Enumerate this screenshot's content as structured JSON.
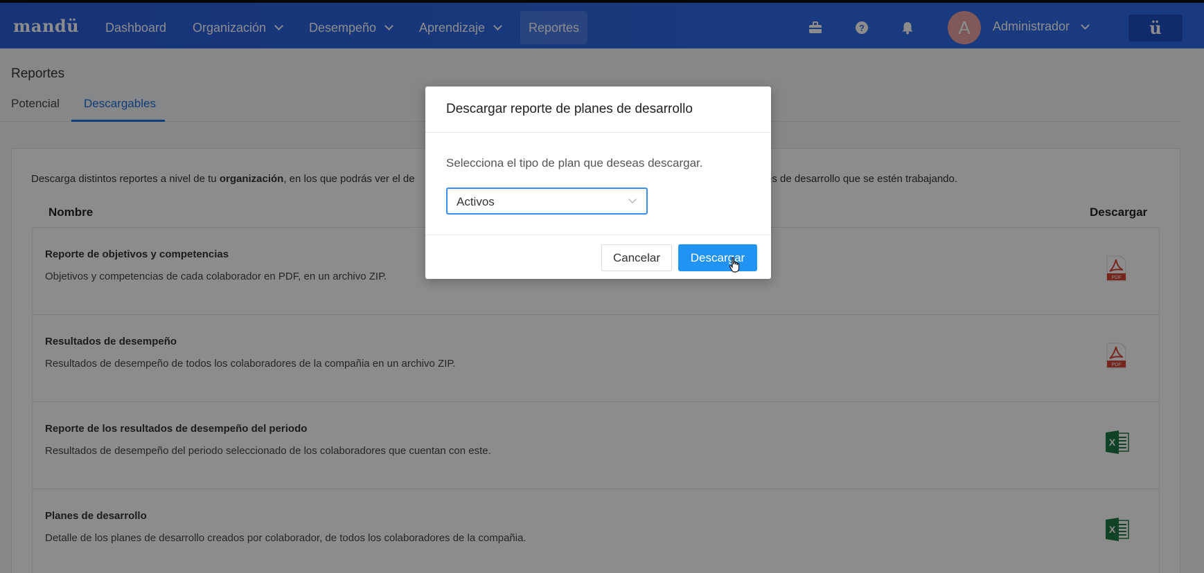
{
  "navbar": {
    "logo": "mandü",
    "items": [
      {
        "label": "Dashboard"
      },
      {
        "label": "Organización"
      },
      {
        "label": "Desempeño"
      },
      {
        "label": "Aprendizaje"
      },
      {
        "label": "Reportes"
      }
    ],
    "user": {
      "initial": "A",
      "name": "Administrador"
    },
    "brand_button": "ü",
    "icons": [
      "briefcase-icon",
      "help-icon",
      "bell-icon"
    ]
  },
  "page": {
    "title": "Reportes",
    "tabs": [
      {
        "label": "Potencial"
      },
      {
        "label": "Descargables"
      }
    ],
    "active_tab": "Descargables"
  },
  "content": {
    "intro_start": "Descarga distintos reportes a nivel de tu ",
    "intro_bold": "organización",
    "intro_mid": ", en los que podrás ver el de",
    "intro_end": "es de desarrollo que se estén trabajando.",
    "columns": {
      "name": "Nombre",
      "download": "Descargar"
    },
    "rows": [
      {
        "title": "Reporte de objetivos y competencias",
        "description": "Objetivos y competencias de cada colaborador en PDF, en un archivo ZIP.",
        "icon": "pdf-icon"
      },
      {
        "title": "Resultados de desempeño",
        "description": "Resultados de desempeño de todos los colaboradores de la compañia en un archivo ZIP.",
        "icon": "pdf-icon"
      },
      {
        "title": "Reporte de los resultados de desempeño del periodo",
        "description": "Resultados de desempeño del periodo seleccionado de los colaboradores que cuentan con este.",
        "icon": "excel-icon"
      },
      {
        "title": "Planes de desarrollo",
        "description": "Detalle de los planes de desarrollo creados por colaborador, de todos los colaboradores de la compañia.",
        "icon": "excel-icon"
      }
    ]
  },
  "modal": {
    "title": "Descargar reporte de planes de desarrollo",
    "prompt": "Selecciona el tipo de plan que deseas descargar.",
    "select_value": "Activos",
    "cancel_label": "Cancelar",
    "confirm_label": "Descargar"
  },
  "colors": {
    "nav": "#2f6ae6",
    "accent": "#1f6fdc",
    "primary_button": "#2193f5",
    "pdf": "#d9443a",
    "excel": "#1e7a44"
  }
}
